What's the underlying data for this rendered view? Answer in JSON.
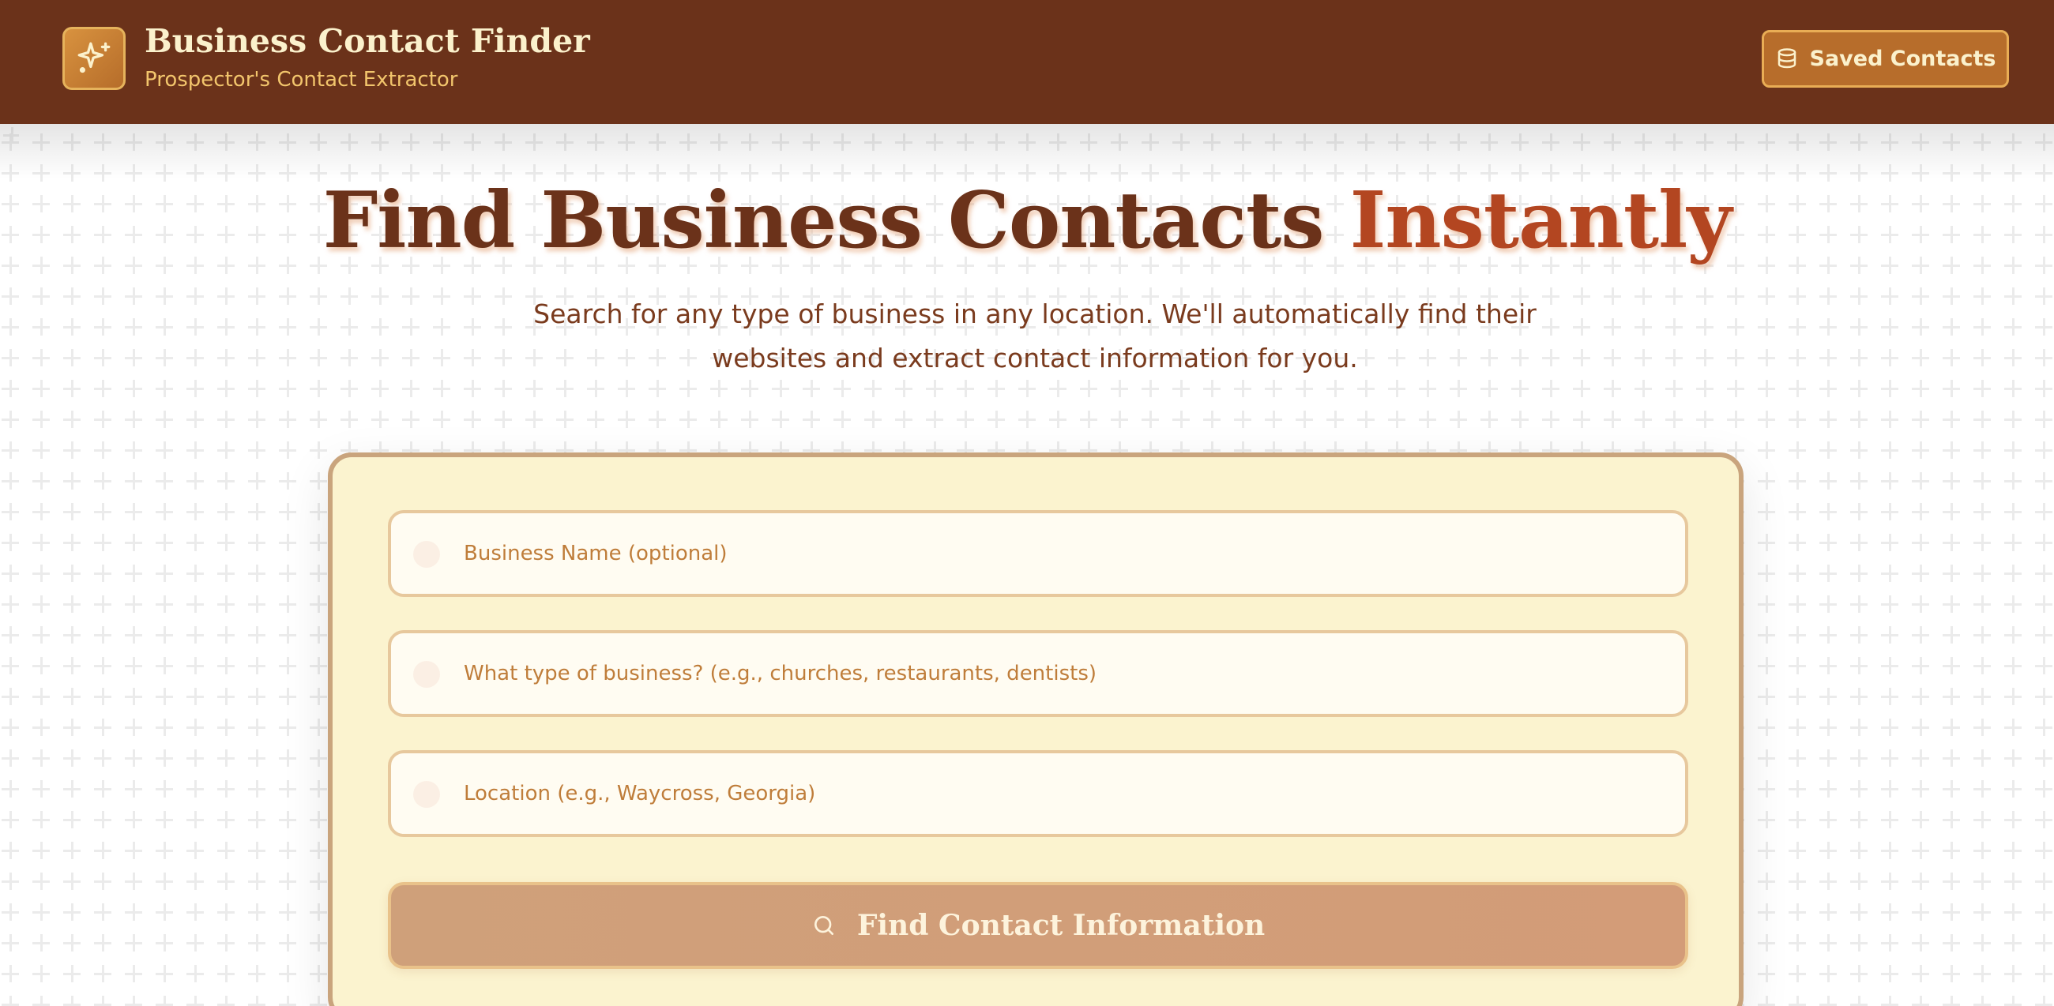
{
  "header": {
    "title": "Business Contact Finder",
    "subtitle": "Prospector's Contact Extractor",
    "saved_contacts_label": "Saved Contacts",
    "logo_icon": "sparkles-icon",
    "saved_icon": "database-icon"
  },
  "hero": {
    "title_main": "Find Business Contacts",
    "title_accent": "Instantly",
    "description": "Search for any type of business in any location. We'll automatically find their websites and extract contact information for you."
  },
  "form": {
    "business_name": {
      "placeholder": "Business Name (optional)",
      "value": ""
    },
    "business_type": {
      "placeholder": "What type of business? (e.g., churches, restaurants, dentists)",
      "value": ""
    },
    "location": {
      "placeholder": "Location (e.g., Waycross, Georgia)",
      "value": ""
    },
    "submit_label": "Find Contact Information",
    "submit_icon": "search-icon"
  },
  "colors": {
    "header_bg": "#6b321a",
    "title_color": "#6b321a",
    "accent_color": "#b34621",
    "card_bg": "#fbf3cf",
    "button_bg": "#cfa07a",
    "saved_button_bg": "#b76d2b"
  }
}
